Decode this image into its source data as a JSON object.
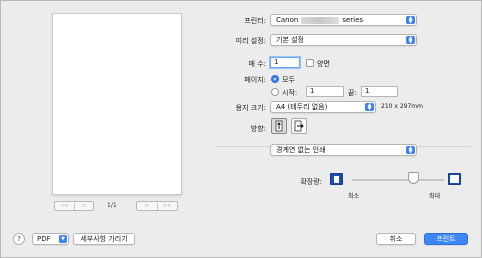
{
  "preview": {
    "pager_first": "<<",
    "pager_prev": "<",
    "pager_next": ">",
    "pager_last": ">>",
    "page_indicator": "1/1"
  },
  "form": {
    "printer_label": "프린터:",
    "printer_value_prefix": "Canon",
    "printer_value_suffix": "series",
    "presets_label": "미리 설정:",
    "presets_value": "기본 설정",
    "copies_label": "매 수:",
    "copies_value": "1",
    "duplex_label": "양면",
    "pages_label": "페이지:",
    "pages_all_label": "모두",
    "pages_from_label": "시작:",
    "pages_from_value": "1",
    "pages_to_label": "끝:",
    "pages_to_value": "1",
    "paper_size_label": "용지 크기:",
    "paper_size_value": "A4 (테두리 없음)",
    "paper_size_dims": "210 x 297mm",
    "orientation_label": "방향:",
    "section_value": "경계연 없는 인쇄",
    "extension_label": "확장량:",
    "min_label": "최소",
    "max_label": "최대"
  },
  "footer": {
    "help_label": "?",
    "pdf_label": "PDF",
    "hide_details_label": "세부사항 가리기",
    "cancel_label": "취소",
    "print_label": "프린트"
  },
  "state": {
    "pages_all_selected": true,
    "duplex_checked": false,
    "orientation": "portrait",
    "extension_level": 0.67
  },
  "colors": {
    "accent": "#3b82f0",
    "primary_button": "#3d87f5",
    "dialog_background": "#ececec"
  },
  "icons": {
    "help": "question-mark-icon",
    "popup_arrows": "up-down-chevron-icon",
    "portrait": "portrait-orientation-icon",
    "landscape": "landscape-orientation-icon",
    "scale_min": "scale-minimum-icon",
    "scale_max": "scale-maximum-icon"
  }
}
